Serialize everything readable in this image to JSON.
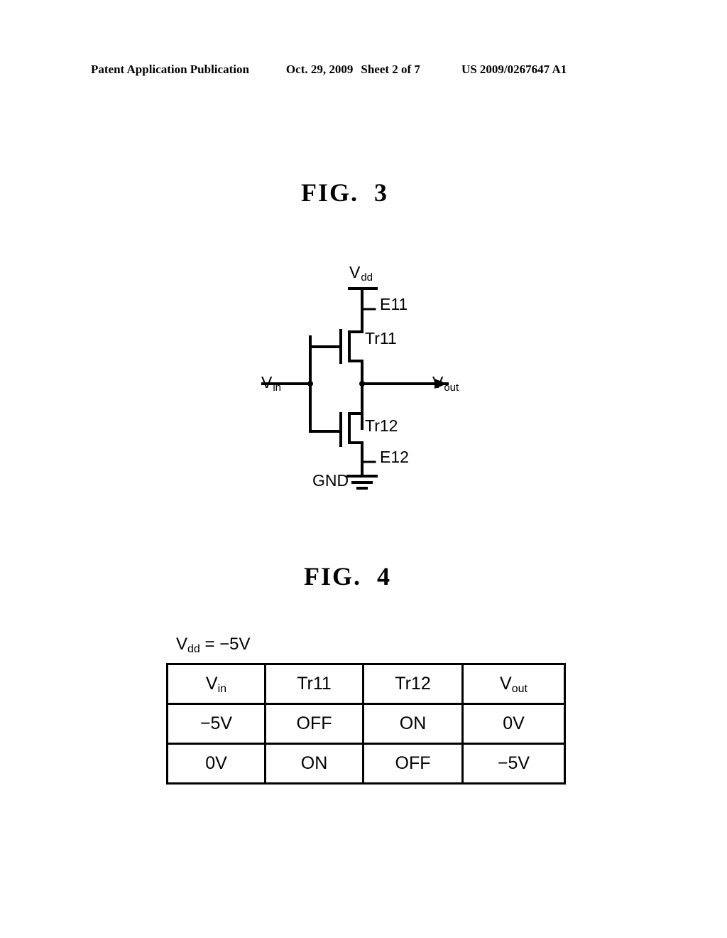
{
  "header": {
    "publication": "Patent Application Publication",
    "date": "Oct. 29, 2009",
    "sheet": "Sheet 2 of 7",
    "patent_number": "US 2009/0267647 A1"
  },
  "figures": [
    {
      "word": "FIG.",
      "number": "3",
      "type": "circuit-diagram",
      "labels": {
        "vdd": "V",
        "vdd_sub": "dd",
        "e11": "E11",
        "tr11": "Tr11",
        "vin": "V",
        "vin_sub": "in",
        "vout": "V",
        "vout_sub": "out",
        "tr12": "Tr12",
        "e12": "E12",
        "gnd": "GND"
      }
    },
    {
      "word": "FIG.",
      "number": "4",
      "type": "table"
    }
  ],
  "fig4": {
    "caption_main": "V",
    "caption_sub": "dd",
    "caption_rest": " = −5V",
    "table": {
      "headers": [
        {
          "main": "V",
          "sub": "in"
        },
        {
          "main": "Tr11",
          "sub": ""
        },
        {
          "main": "Tr12",
          "sub": ""
        },
        {
          "main": "V",
          "sub": "out"
        }
      ],
      "rows": [
        [
          {
            "main": "−5V",
            "sub": ""
          },
          {
            "main": "OFF",
            "sub": ""
          },
          {
            "main": "ON",
            "sub": ""
          },
          {
            "main": "0V",
            "sub": ""
          }
        ],
        [
          {
            "main": "0V",
            "sub": ""
          },
          {
            "main": "ON",
            "sub": ""
          },
          {
            "main": "OFF",
            "sub": ""
          },
          {
            "main": "−5V",
            "sub": ""
          }
        ]
      ]
    }
  },
  "colors": {
    "ink": "#000000",
    "paper": "#ffffff"
  }
}
